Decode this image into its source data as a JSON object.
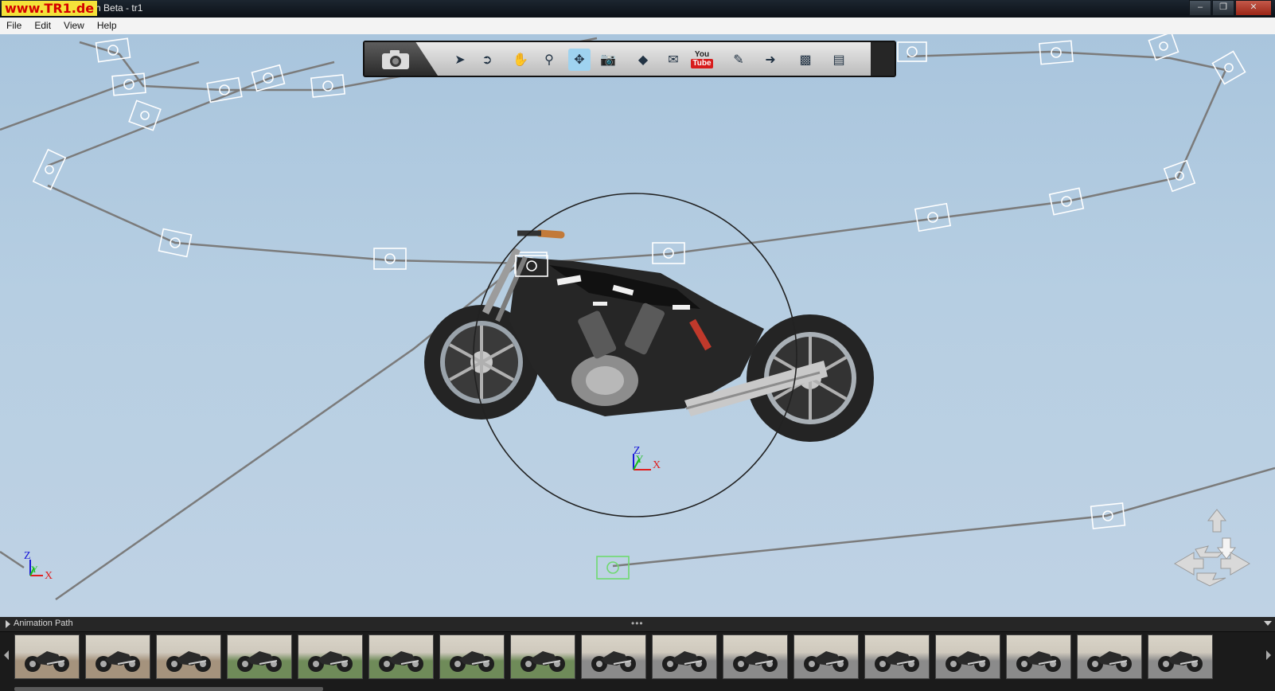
{
  "window": {
    "title": "atch Beta - tr1",
    "watermark": "www.TR1.de",
    "buttons": [
      "minimize",
      "maximize",
      "close"
    ]
  },
  "menu": [
    "File",
    "Edit",
    "View",
    "Help"
  ],
  "toolbar": {
    "tools": [
      {
        "name": "camera-icon",
        "active": false
      },
      {
        "name": "select-icon",
        "active": false
      },
      {
        "name": "select-region-icon",
        "active": false
      },
      {
        "name": "pan-hand-icon",
        "active": false
      },
      {
        "name": "zoom-icon",
        "active": false
      },
      {
        "name": "orbit-icon",
        "active": true
      },
      {
        "name": "camera-lock-icon",
        "active": false
      },
      {
        "name": "ruler-icon",
        "active": false
      },
      {
        "name": "email-icon",
        "active": false
      },
      {
        "name": "youtube-icon",
        "active": false
      },
      {
        "name": "eyedropper-icon",
        "active": false
      },
      {
        "name": "export-icon",
        "active": false
      },
      {
        "name": "download-cube-icon",
        "active": false
      },
      {
        "name": "properties-icon",
        "active": false
      }
    ],
    "youtube": {
      "top": "You",
      "bottom": "Tube"
    }
  },
  "axes": {
    "z": "Z",
    "y": "Y",
    "x": "X"
  },
  "colors": {
    "accent": "#9fd3f0",
    "sky_top": "#a9c5dd",
    "sky_bottom": "#bfd2e4",
    "path_line": "#7d7d7d",
    "axis_x": "#e02020",
    "axis_y": "#18c018",
    "axis_z": "#1818d8"
  },
  "animation_panel": {
    "label": "Animation Path",
    "thumbnail_count": 17
  }
}
